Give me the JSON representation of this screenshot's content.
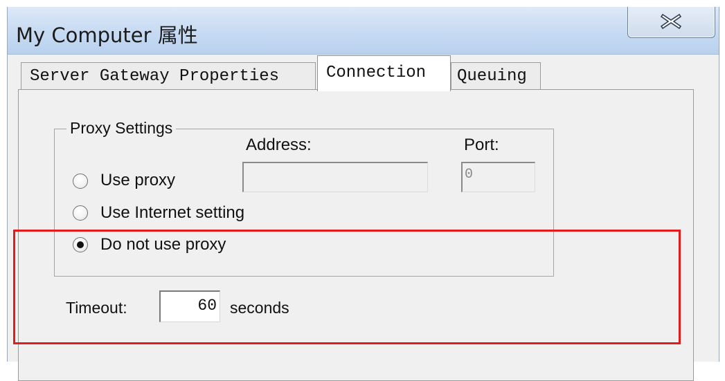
{
  "window": {
    "title": "My Computer 属性",
    "close_glyph": "close-icon"
  },
  "tabs": [
    {
      "label": "Server Gateway Properties",
      "selected": false
    },
    {
      "label": "Connection",
      "selected": true
    },
    {
      "label": "Queuing",
      "selected": false
    }
  ],
  "proxy": {
    "group_title": "Proxy Settings",
    "address_label": "Address:",
    "port_label": "Port:",
    "address_value": "",
    "port_value": "0",
    "options": [
      {
        "label": "Use proxy",
        "selected": false
      },
      {
        "label": "Use Internet setting",
        "selected": false
      },
      {
        "label": "Do not use proxy",
        "selected": true
      }
    ]
  },
  "timeout": {
    "label": "Timeout:",
    "value": "60",
    "unit": "seconds"
  },
  "colors": {
    "highlight": "#e31b1b",
    "titlebar": "#c6daf2"
  }
}
